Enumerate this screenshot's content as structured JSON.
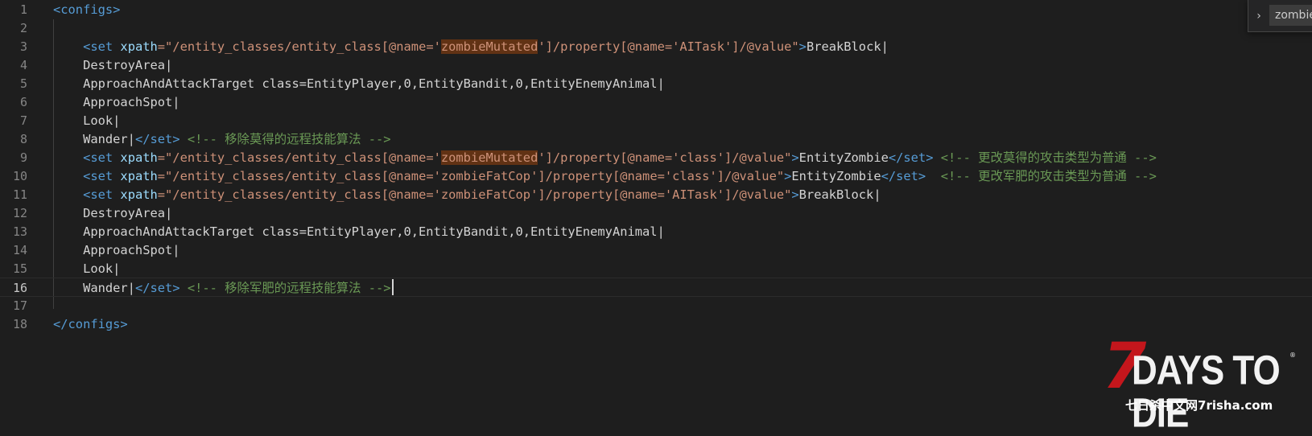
{
  "editor": {
    "current_line": 16,
    "lines": [
      {
        "n": "1",
        "tokens": [
          {
            "t": "<configs>",
            "c": "tag"
          }
        ]
      },
      {
        "n": "2",
        "tokens": []
      },
      {
        "n": "3",
        "tokens": [
          {
            "t": "    ",
            "c": "text"
          },
          {
            "t": "<set ",
            "c": "tag"
          },
          {
            "t": "xpath",
            "c": "attr"
          },
          {
            "t": "=\"/entity_classes/entity_class[@name='",
            "c": "str"
          },
          {
            "t": "zombieMutated",
            "c": "str",
            "hl": true
          },
          {
            "t": "']/property[@name='AITask']/@value\"",
            "c": "str"
          },
          {
            "t": ">",
            "c": "tag"
          },
          {
            "t": "BreakBlock|",
            "c": "text"
          }
        ]
      },
      {
        "n": "4",
        "tokens": [
          {
            "t": "    DestroyArea|",
            "c": "text"
          }
        ]
      },
      {
        "n": "5",
        "tokens": [
          {
            "t": "    ApproachAndAttackTarget class=EntityPlayer,0,EntityBandit,0,EntityEnemyAnimal|",
            "c": "text"
          }
        ]
      },
      {
        "n": "6",
        "tokens": [
          {
            "t": "    ApproachSpot|",
            "c": "text"
          }
        ]
      },
      {
        "n": "7",
        "tokens": [
          {
            "t": "    Look|",
            "c": "text"
          }
        ]
      },
      {
        "n": "8",
        "tokens": [
          {
            "t": "    Wander|",
            "c": "text"
          },
          {
            "t": "</set>",
            "c": "tag"
          },
          {
            "t": " ",
            "c": "text"
          },
          {
            "t": "<!-- 移除莫得的远程技能算法 -->",
            "c": "comment"
          }
        ]
      },
      {
        "n": "9",
        "tokens": [
          {
            "t": "    ",
            "c": "text"
          },
          {
            "t": "<set ",
            "c": "tag"
          },
          {
            "t": "xpath",
            "c": "attr"
          },
          {
            "t": "=\"/entity_classes/entity_class[@name='",
            "c": "str"
          },
          {
            "t": "zombieMutated",
            "c": "str",
            "hl": true
          },
          {
            "t": "']/property[@name='class']/@value\"",
            "c": "str"
          },
          {
            "t": ">",
            "c": "tag"
          },
          {
            "t": "EntityZombie",
            "c": "text"
          },
          {
            "t": "</set>",
            "c": "tag"
          },
          {
            "t": " ",
            "c": "text"
          },
          {
            "t": "<!-- 更改莫得的攻击类型为普通 -->",
            "c": "comment"
          }
        ]
      },
      {
        "n": "10",
        "tokens": [
          {
            "t": "    ",
            "c": "text"
          },
          {
            "t": "<set ",
            "c": "tag"
          },
          {
            "t": "xpath",
            "c": "attr"
          },
          {
            "t": "=\"/entity_classes/entity_class[@name='zombieFatCop']/property[@name='class']/@value\"",
            "c": "str"
          },
          {
            "t": ">",
            "c": "tag"
          },
          {
            "t": "EntityZombie",
            "c": "text"
          },
          {
            "t": "</set>",
            "c": "tag"
          },
          {
            "t": "  ",
            "c": "text"
          },
          {
            "t": "<!-- 更改军肥的攻击类型为普通 -->",
            "c": "comment"
          }
        ]
      },
      {
        "n": "11",
        "tokens": [
          {
            "t": "    ",
            "c": "text"
          },
          {
            "t": "<set ",
            "c": "tag"
          },
          {
            "t": "xpath",
            "c": "attr"
          },
          {
            "t": "=\"/entity_classes/entity_class[@name='zombieFatCop']/property[@name='AITask']/@value\"",
            "c": "str"
          },
          {
            "t": ">",
            "c": "tag"
          },
          {
            "t": "BreakBlock|",
            "c": "text"
          }
        ]
      },
      {
        "n": "12",
        "tokens": [
          {
            "t": "    DestroyArea|",
            "c": "text"
          }
        ]
      },
      {
        "n": "13",
        "tokens": [
          {
            "t": "    ApproachAndAttackTarget class=EntityPlayer,0,EntityBandit,0,EntityEnemyAnimal|",
            "c": "text"
          }
        ]
      },
      {
        "n": "14",
        "tokens": [
          {
            "t": "    ApproachSpot|",
            "c": "text"
          }
        ]
      },
      {
        "n": "15",
        "tokens": [
          {
            "t": "    Look|",
            "c": "text"
          }
        ]
      },
      {
        "n": "16",
        "tokens": [
          {
            "t": "    Wander|",
            "c": "text"
          },
          {
            "t": "</set>",
            "c": "tag"
          },
          {
            "t": " ",
            "c": "text"
          },
          {
            "t": "<!-- 移除军肥的远程技能算法 -->",
            "c": "comment"
          }
        ]
      },
      {
        "n": "17",
        "tokens": []
      },
      {
        "n": "18",
        "tokens": [
          {
            "t": "</configs>",
            "c": "tag"
          }
        ]
      }
    ]
  },
  "find_widget": {
    "toggle_icon": "chevron-right-icon",
    "query": "zombieMutated"
  },
  "logo": {
    "seven": "7",
    "title": "DAYS TO DIE",
    "registered": "®",
    "subtitle": "七日杀中文网7risha.com",
    "accent_color": "#c4161c"
  }
}
